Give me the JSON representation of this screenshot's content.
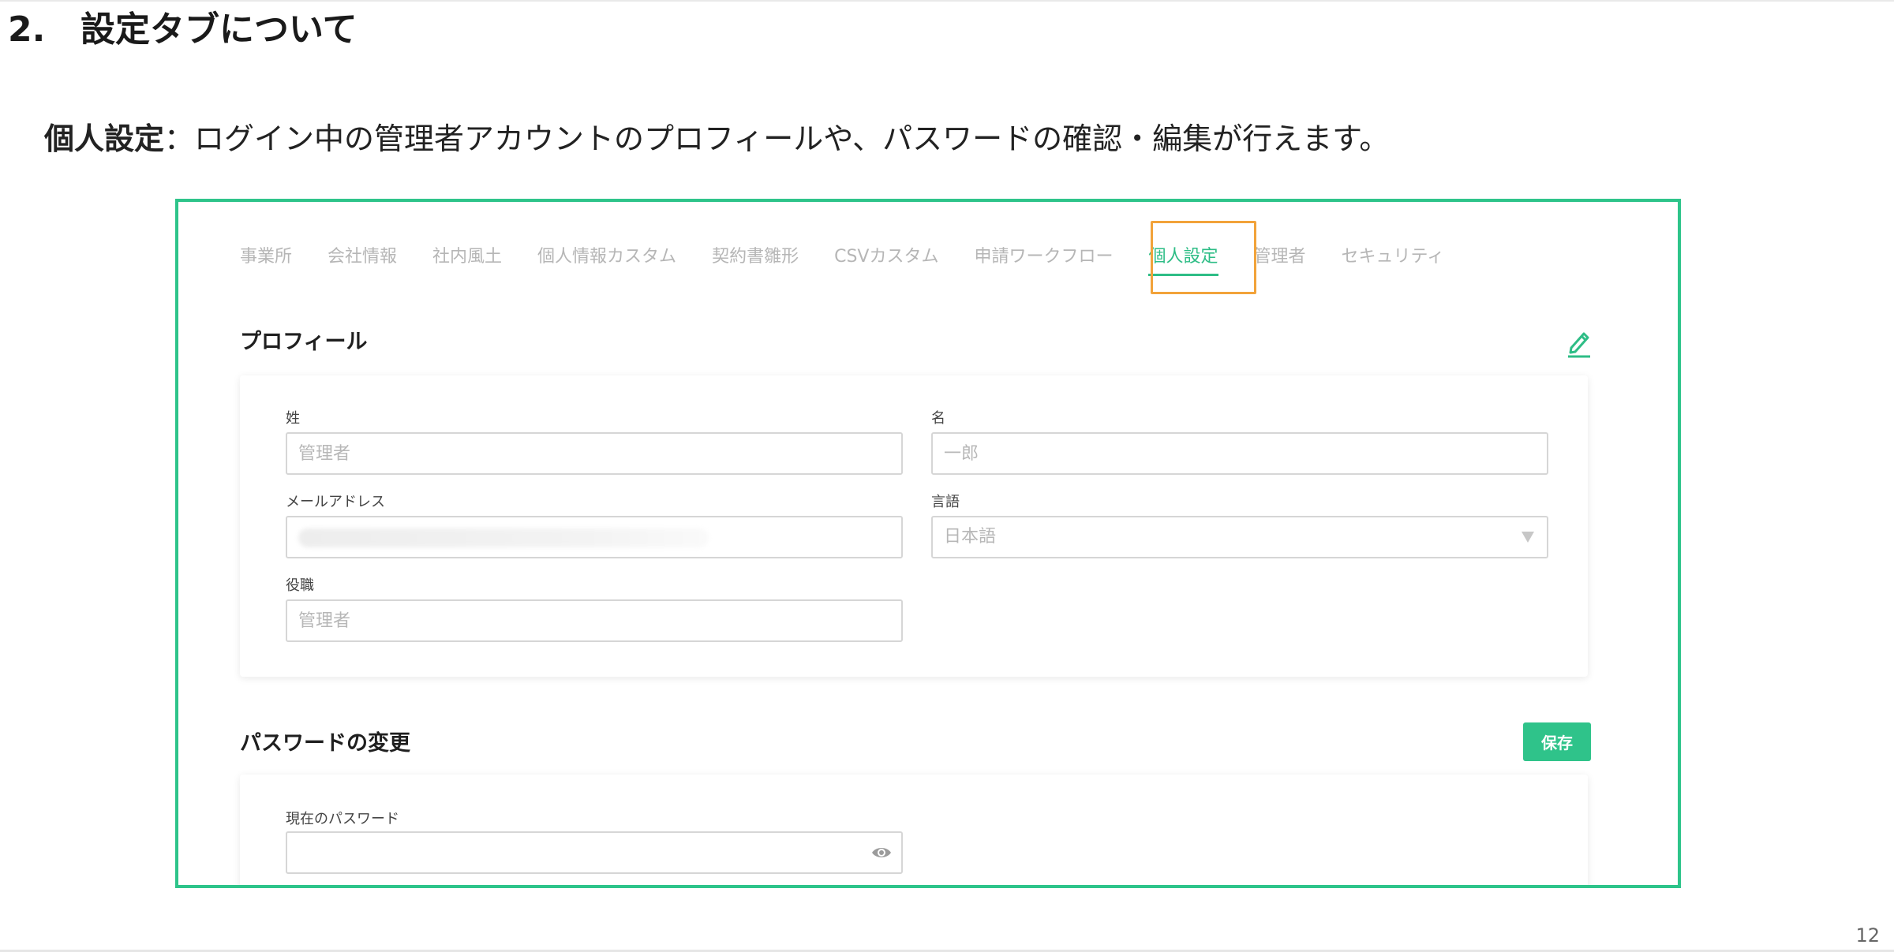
{
  "slide": {
    "number": "2.",
    "title": "設定タブについて",
    "description_bold": "個人設定",
    "description_text": "：ログイン中の管理者アカウントのプロフィールや、パスワードの確認・編集が行えます。",
    "page_number": "12"
  },
  "tabs": [
    {
      "label": "事業所",
      "active": false
    },
    {
      "label": "会社情報",
      "active": false
    },
    {
      "label": "社内風土",
      "active": false
    },
    {
      "label": "個人情報カスタム",
      "active": false
    },
    {
      "label": "契約書雛形",
      "active": false
    },
    {
      "label": "CSVカスタム",
      "active": false
    },
    {
      "label": "申請ワークフロー",
      "active": false
    },
    {
      "label": "個人設定",
      "active": true
    },
    {
      "label": "管理者",
      "active": false
    },
    {
      "label": "セキュリティ",
      "active": false
    }
  ],
  "profile": {
    "title": "プロフィール",
    "last_name": {
      "label": "姓",
      "placeholder": "管理者"
    },
    "first_name": {
      "label": "名",
      "placeholder": "一郎"
    },
    "email": {
      "label": "メールアドレス",
      "value": ""
    },
    "language": {
      "label": "言語",
      "value": "日本語"
    },
    "position": {
      "label": "役職",
      "placeholder": "管理者"
    }
  },
  "password": {
    "title": "パスワードの変更",
    "save_label": "保存",
    "current": {
      "label": "現在のパスワード",
      "value": ""
    }
  },
  "colors": {
    "accent": "#2ebd86",
    "frame_border": "#2ec48a",
    "highlight": "#f2a33a",
    "tab_inactive": "#b6b6b6"
  },
  "icons": [
    "edit-pencil-icon",
    "eye-icon",
    "chevron-down-icon"
  ]
}
